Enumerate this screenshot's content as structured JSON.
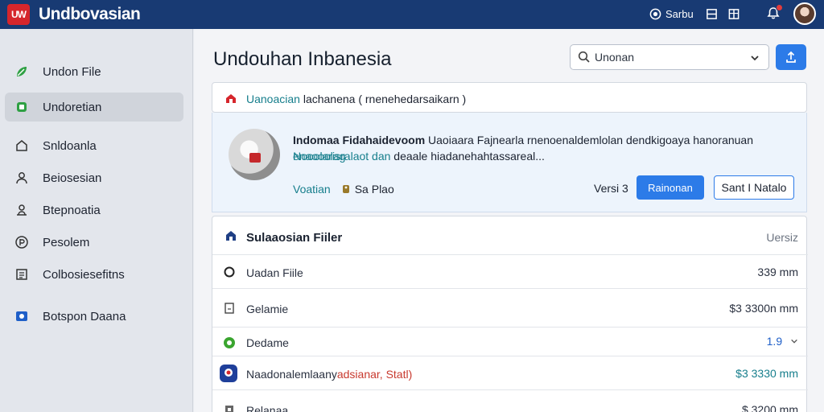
{
  "app": {
    "title": "Undbovasian",
    "logo_text": "UW"
  },
  "topbar": {
    "action_label": "Sarbu"
  },
  "sidebar": {
    "items": [
      {
        "label": "Undon File",
        "icon": "leaf-icon"
      },
      {
        "label": "Undoretian",
        "icon": "app-icon"
      },
      {
        "label": "Snldoanla",
        "icon": "home-icon"
      },
      {
        "label": "Beiosesian",
        "icon": "user-icon"
      },
      {
        "label": "Btepnoatia",
        "icon": "users-icon"
      },
      {
        "label": "Pesolem",
        "icon": "currency-icon"
      },
      {
        "label": "Colbosiesefitns",
        "icon": "list-icon"
      },
      {
        "label": "Botspon Daana",
        "icon": "folder-icon"
      }
    ]
  },
  "main": {
    "title": "Undouhan Inbanesia",
    "search": {
      "value": "Unonan"
    },
    "header_card": {
      "teal_text": "Uanoacian",
      "text": "lachanena",
      "paren": "( rnenehedarsaikarn )"
    },
    "featured": {
      "name": "Indomaa Fidahaidevoom",
      "description_line1": "Uaoiaara Fajnearla rnenoenaldemlolan dendkigoaya hanoranuan",
      "description_line1_teal": "enaooolag",
      "description_line2_teal": "Nooolarisralaot dan",
      "description_line2": "deaale hiadanehahtassareal...",
      "meta_teal": "Voatian",
      "meta_text": "Sa Plao",
      "version": "Versi 3",
      "primary_button": "Rainonan",
      "secondary_button": "Sant I Natalo"
    },
    "file_list": {
      "title": "Sulaaosian Fiiler",
      "column_label": "Uersiz",
      "rows": [
        {
          "label": "Uadan Fiile",
          "value": "339 mm"
        },
        {
          "label": "Gelamie",
          "value": "$3 3300n mm"
        },
        {
          "label": "Dedame",
          "value": "1.9"
        },
        {
          "label": "Naadonalemlaany",
          "label_red": "adsianar, Statl)",
          "value": "$3 3330 mm"
        },
        {
          "label": "Relanaa",
          "value": "$ 3200 mm"
        }
      ]
    }
  }
}
